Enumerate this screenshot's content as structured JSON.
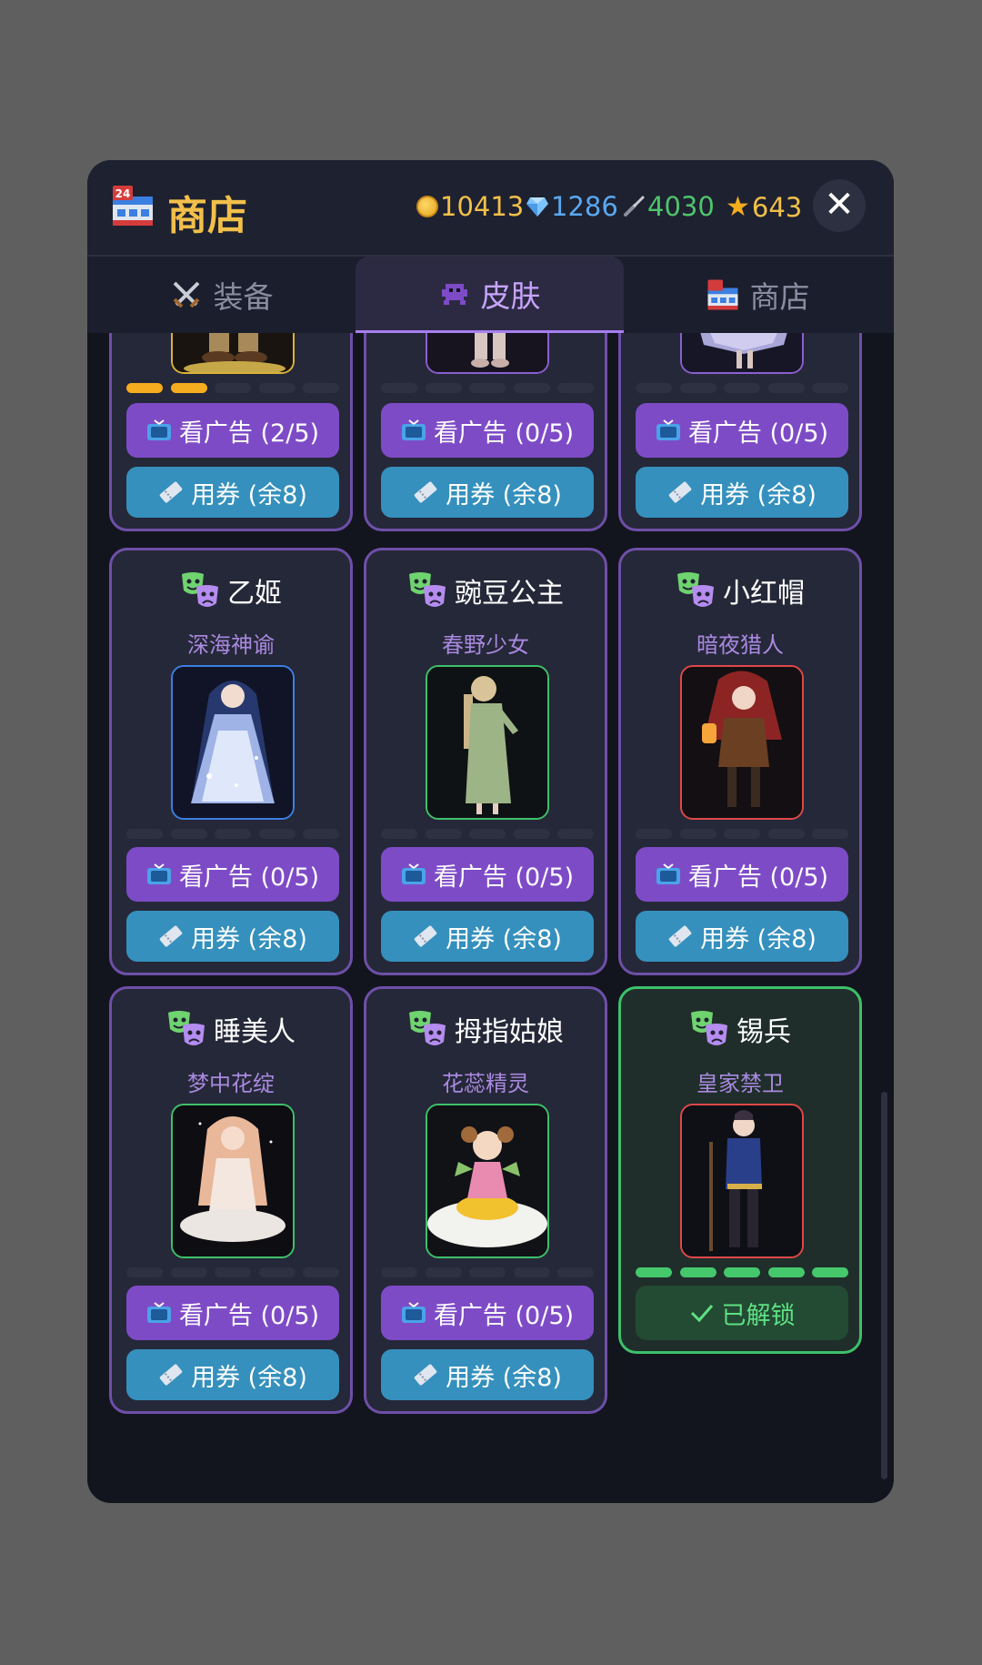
{
  "header": {
    "title": "商店",
    "currencies": {
      "coins": "10413",
      "diamonds": "1286",
      "tools": "4030",
      "stars": "643"
    },
    "colors": {
      "coins": "#f2c04a",
      "diamonds": "#5aa8f0",
      "tools": "#4fc46c",
      "stars": "#f2c04a"
    }
  },
  "tabs": [
    {
      "label": "装备",
      "icon": "crossed-swords-icon"
    },
    {
      "label": "皮肤",
      "icon": "alien-monster-icon",
      "active": true
    },
    {
      "label": "商店",
      "icon": "convenience-store-icon"
    }
  ],
  "top_row": [
    {
      "ad_label": "看广告 (2/5)",
      "coupon_label": "用券 (余8)",
      "progress": 2,
      "frame": "#d9b23a"
    },
    {
      "ad_label": "看广告 (0/5)",
      "coupon_label": "用券 (余8)",
      "progress": 0,
      "frame": "#8a5fd0"
    },
    {
      "ad_label": "看广告 (0/5)",
      "coupon_label": "用券 (余8)",
      "progress": 0,
      "frame": "#8a5fd0"
    }
  ],
  "cards": [
    {
      "name": "乙姬",
      "skin": "深海神谕",
      "ad_label": "看广告 (0/5)",
      "coupon_label": "用券 (余8)",
      "progress": 0,
      "frame": "#3b7fe0"
    },
    {
      "name": "豌豆公主",
      "skin": "春野少女",
      "ad_label": "看广告 (0/5)",
      "coupon_label": "用券 (余8)",
      "progress": 0,
      "frame": "#3ec06a"
    },
    {
      "name": "小红帽",
      "skin": "暗夜猎人",
      "ad_label": "看广告 (0/5)",
      "coupon_label": "用券 (余8)",
      "progress": 0,
      "frame": "#e04848"
    },
    {
      "name": "睡美人",
      "skin": "梦中花绽",
      "ad_label": "看广告 (0/5)",
      "coupon_label": "用券 (余8)",
      "progress": 0,
      "frame": "#3ec06a"
    },
    {
      "name": "拇指姑娘",
      "skin": "花蕊精灵",
      "ad_label": "看广告 (0/5)",
      "coupon_label": "用券 (余8)",
      "progress": 0,
      "frame": "#3ec06a"
    },
    {
      "name": "锡兵",
      "skin": "皇家禁卫",
      "unlocked_label": "已解锁",
      "progress": 5,
      "frame": "#e04848",
      "unlocked": true
    }
  ],
  "progress_max": 5
}
